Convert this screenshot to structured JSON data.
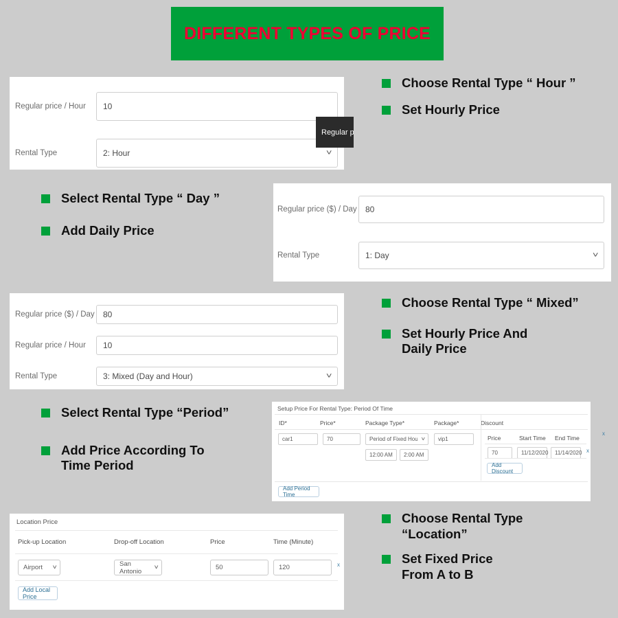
{
  "banner": {
    "title": "DIFFERENT TYPES OF PRICE",
    "bg_color": "#00a03a",
    "text_color": "#ee0033"
  },
  "theme": {
    "page_bg": "#cccccc",
    "bullet_color": "#00a03a",
    "panel_bg": "#ffffff",
    "link_color": "#2b6f94"
  },
  "sections": {
    "hour": {
      "bullets": [
        "Choose Rental Type “ Hour ”",
        "Set Hourly Price"
      ],
      "fields": {
        "price_label": "Regular price / Hour",
        "price_value": "10",
        "rental_type_label": "Rental Type",
        "rental_type_value": "2: Hour"
      },
      "tooltip": "Regular p"
    },
    "day": {
      "bullets": [
        "Select Rental Type “ Day ”",
        "Add Daily Price"
      ],
      "fields": {
        "price_label": "Regular price ($) / Day",
        "price_value": "80",
        "rental_type_label": "Rental Type",
        "rental_type_value": "1: Day"
      }
    },
    "mixed": {
      "bullets": [
        "Choose Rental Type “ Mixed”",
        "Set Hourly Price And\nDaily Price"
      ],
      "fields": {
        "day_price_label": "Regular price ($) / Day",
        "day_price_value": "80",
        "hour_price_label": "Regular price / Hour",
        "hour_price_value": "10",
        "rental_type_label": "Rental Type",
        "rental_type_value": "3: Mixed (Day and Hour)"
      }
    },
    "period": {
      "bullets": [
        "Select Rental Type “Period”",
        "Add Price According To\nTime Period"
      ],
      "panel_title": "Setup Price For Rental Type: Period Of Time",
      "columns": [
        "ID*",
        "Price*",
        "Package Type*",
        "Package*",
        "Discount"
      ],
      "row": {
        "id": "car1",
        "price": "70",
        "package_type": "Period of Fixed Hours in day",
        "start_hour": "12:00 AM",
        "end_hour": "2:00 AM",
        "package": "vip1"
      },
      "discount": {
        "columns": [
          "Price",
          "Start Time",
          "End Time"
        ],
        "price": "70",
        "start_time": "11/12/2020",
        "end_time": "11/14/2020",
        "add_button": "Add Discount"
      },
      "add_period_button": "Add Period Time",
      "remove_marks": [
        "x",
        "x"
      ]
    },
    "location": {
      "bullets": [
        "Choose Rental Type\n “Location”",
        "Set Fixed Price\nFrom A to B"
      ],
      "panel_title": "Location Price",
      "columns": [
        "Pick-up Location",
        "Drop-off Location",
        "Price",
        "Time (Minute)"
      ],
      "row": {
        "pickup": "Airport",
        "dropoff": "San Antonio",
        "price": "50",
        "time": "120"
      },
      "add_button": "Add Local Price",
      "remove_mark": "x"
    }
  }
}
